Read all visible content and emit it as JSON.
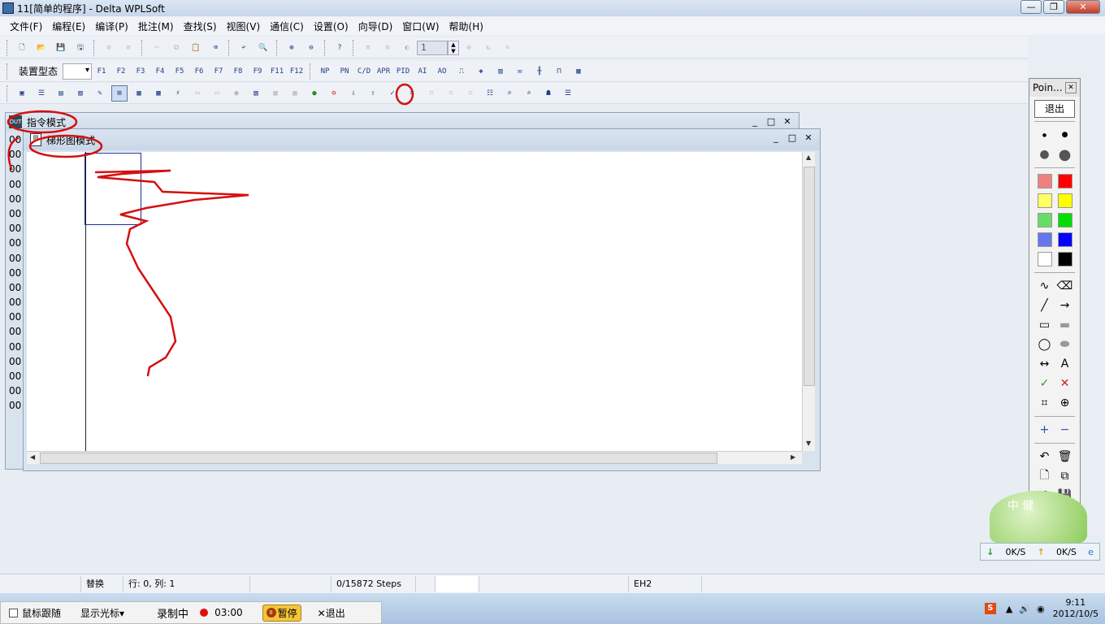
{
  "window": {
    "title": "11[简单的程序] - Delta WPLSoft"
  },
  "menu": [
    "文件(F)",
    "编程(E)",
    "编译(P)",
    "批注(M)",
    "查找(S)",
    "视图(V)",
    "通信(C)",
    "设置(O)",
    "向导(D)",
    "窗口(W)",
    "帮助(H)"
  ],
  "toolbar1": {
    "step_value": "1"
  },
  "toolbar2": {
    "device_label": "装置型态",
    "buttons": [
      "F1",
      "F2",
      "F3",
      "F4",
      "F5",
      "F6",
      "F7",
      "F8",
      "F9",
      "F11",
      "F12",
      "NP",
      "PN",
      "C/D",
      "APR",
      "PID",
      "AI",
      "AO"
    ]
  },
  "instruction_window": {
    "title": "指令模式",
    "lines": [
      "00",
      "00",
      "00",
      "00",
      "00",
      "00",
      "00",
      "00",
      "00",
      "00",
      "00",
      "00",
      "00",
      "00",
      "00",
      "00",
      "00",
      "00",
      "00"
    ]
  },
  "ladder_window": {
    "title": "梯形图模式"
  },
  "status": {
    "mode": "替换",
    "position": "行: 0, 列: 1",
    "steps": "0/15872 Steps",
    "model": "EH2"
  },
  "recorder": {
    "follow_mouse": "鼠标跟随",
    "show_cursor": "显示光标▾",
    "recording": "录制中",
    "time": "03:00",
    "pause": "暂停",
    "exit": "✕退出"
  },
  "tray": {
    "time": "9:11",
    "date": "2012/10/5"
  },
  "pointer_palette": {
    "title": "Poin...",
    "exit": "退出",
    "colors": [
      "#f08080",
      "#ff0000",
      "#ffff66",
      "#ffff00",
      "#66dd66",
      "#00dd00",
      "#6677ee",
      "#0000ff",
      "#ffffff",
      "#000000"
    ]
  },
  "speed_widget": {
    "down": "0K/S",
    "up": "0K/S"
  },
  "floating_ball": {
    "label": "中 健"
  }
}
